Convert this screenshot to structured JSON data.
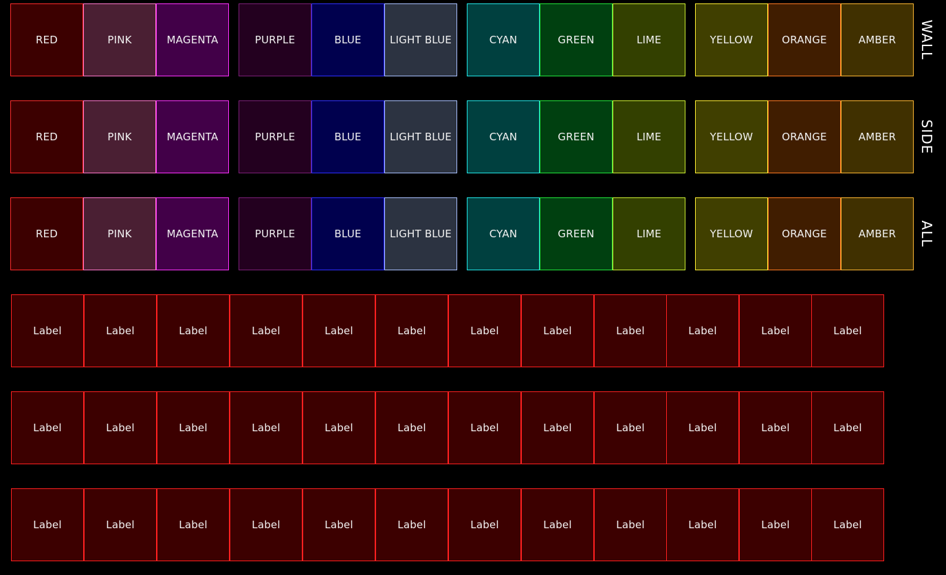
{
  "color_rows": [
    {
      "label": "WALL",
      "tiles": [
        {
          "label": "RED",
          "bg": "#3c0000",
          "border": "#ff2a2a"
        },
        {
          "label": "PINK",
          "bg": "#4a1f33",
          "border": "#ff77cc"
        },
        {
          "label": "MAGENTA",
          "bg": "#420048",
          "border": "#ff33ff"
        },
        {
          "label": "PURPLE",
          "bg": "#23001f",
          "border": "#7a2077"
        },
        {
          "label": "BLUE",
          "bg": "#00004e",
          "border": "#2f2fff"
        },
        {
          "label": "LIGHT BLUE",
          "bg": "#2c3341",
          "border": "#a8c0ff"
        },
        {
          "label": "CYAN",
          "bg": "#00403f",
          "border": "#22e6e6"
        },
        {
          "label": "GREEN",
          "bg": "#004010",
          "border": "#22e63c"
        },
        {
          "label": "LIME",
          "bg": "#334000",
          "border": "#ccee33"
        },
        {
          "label": "YELLOW",
          "bg": "#403f00",
          "border": "#ffee33"
        },
        {
          "label": "ORANGE",
          "bg": "#401d00",
          "border": "#ff7a22"
        },
        {
          "label": "AMBER",
          "bg": "#403000",
          "border": "#ffb833"
        }
      ]
    },
    {
      "label": "SIDE",
      "tiles": [
        {
          "label": "RED",
          "bg": "#3c0000",
          "border": "#ff2a2a"
        },
        {
          "label": "PINK",
          "bg": "#4a1f33",
          "border": "#ff77cc"
        },
        {
          "label": "MAGENTA",
          "bg": "#420048",
          "border": "#ff33ff"
        },
        {
          "label": "PURPLE",
          "bg": "#23001f",
          "border": "#7a2077"
        },
        {
          "label": "BLUE",
          "bg": "#00004e",
          "border": "#2f2fff"
        },
        {
          "label": "LIGHT BLUE",
          "bg": "#2c3341",
          "border": "#a8c0ff"
        },
        {
          "label": "CYAN",
          "bg": "#00403f",
          "border": "#22e6e6"
        },
        {
          "label": "GREEN",
          "bg": "#004010",
          "border": "#22e63c"
        },
        {
          "label": "LIME",
          "bg": "#334000",
          "border": "#ccee33"
        },
        {
          "label": "YELLOW",
          "bg": "#403f00",
          "border": "#ffee33"
        },
        {
          "label": "ORANGE",
          "bg": "#401d00",
          "border": "#ff7a22"
        },
        {
          "label": "AMBER",
          "bg": "#403000",
          "border": "#ffb833"
        }
      ]
    },
    {
      "label": "ALL",
      "tiles": [
        {
          "label": "RED",
          "bg": "#3c0000",
          "border": "#ff2a2a"
        },
        {
          "label": "PINK",
          "bg": "#4a1f33",
          "border": "#ff77cc"
        },
        {
          "label": "MAGENTA",
          "bg": "#420048",
          "border": "#ff33ff"
        },
        {
          "label": "PURPLE",
          "bg": "#23001f",
          "border": "#7a2077"
        },
        {
          "label": "BLUE",
          "bg": "#00004e",
          "border": "#2f2fff"
        },
        {
          "label": "LIGHT BLUE",
          "bg": "#2c3341",
          "border": "#a8c0ff"
        },
        {
          "label": "CYAN",
          "bg": "#00403f",
          "border": "#22e6e6"
        },
        {
          "label": "GREEN",
          "bg": "#004010",
          "border": "#22e63c"
        },
        {
          "label": "LIME",
          "bg": "#334000",
          "border": "#ccee33"
        },
        {
          "label": "YELLOW",
          "bg": "#403f00",
          "border": "#ffee33"
        },
        {
          "label": "ORANGE",
          "bg": "#401d00",
          "border": "#ff7a22"
        },
        {
          "label": "AMBER",
          "bg": "#403000",
          "border": "#ffb833"
        }
      ]
    }
  ],
  "label_rows": [
    {
      "tiles": [
        "Label",
        "Label",
        "Label",
        "Label",
        "Label",
        "Label",
        "Label",
        "Label",
        "Label",
        "Label",
        "Label",
        "Label"
      ]
    },
    {
      "tiles": [
        "Label",
        "Label",
        "Label",
        "Label",
        "Label",
        "Label",
        "Label",
        "Label",
        "Label",
        "Label",
        "Label",
        "Label"
      ]
    },
    {
      "tiles": [
        "Label",
        "Label",
        "Label",
        "Label",
        "Label",
        "Label",
        "Label",
        "Label",
        "Label",
        "Label",
        "Label",
        "Label"
      ]
    }
  ],
  "label_tile_colors": {
    "bg": "#3c0000",
    "border": "#ff2020"
  }
}
